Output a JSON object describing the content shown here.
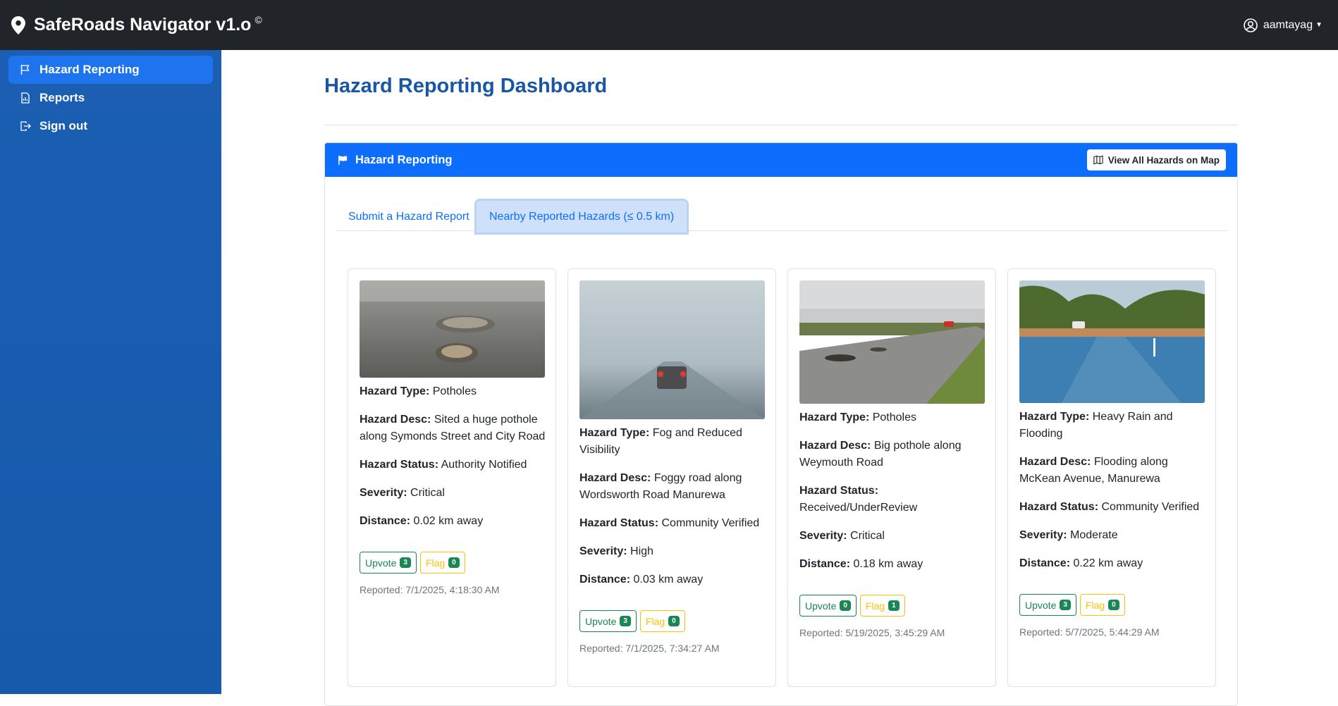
{
  "app": {
    "title": "SafeRoads Navigator v1.o",
    "copyright_mark": "©",
    "user": "aamtayag"
  },
  "sidebar": {
    "items": [
      {
        "label": "Hazard Reporting",
        "icon": "flag-icon",
        "active": true
      },
      {
        "label": "Reports",
        "icon": "report-icon",
        "active": false
      },
      {
        "label": "Sign out",
        "icon": "sign-out-icon",
        "active": false
      }
    ]
  },
  "main": {
    "page_title": "Hazard Reporting Dashboard",
    "panel": {
      "title": "Hazard Reporting",
      "map_button": "View All Hazards on Map"
    },
    "tabs": [
      {
        "label": "Submit a Hazard Report",
        "active": false
      },
      {
        "label": "Nearby Reported Hazards (≤ 0.5 km)",
        "active": true
      }
    ],
    "field_labels": {
      "type": "Hazard Type:",
      "desc": "Hazard Desc:",
      "status": "Hazard Status:",
      "severity": "Severity:",
      "distance": "Distance:"
    },
    "button_labels": {
      "upvote": "Upvote",
      "flag": "Flag"
    },
    "hazards": [
      {
        "type": "Potholes",
        "desc": "Sited a huge pothole along Symonds Street and City Road",
        "status": "Authority Notified",
        "severity": "Critical",
        "distance": "0.02 km away",
        "upvotes": "3",
        "flags": "0",
        "reported": "Reported: 7/1/2025, 4:18:30 AM",
        "image": "pothole-photo"
      },
      {
        "type": "Fog and Reduced Visibility",
        "desc": "Foggy road along Wordsworth Road Manurewa",
        "status": "Community Verified",
        "severity": "High",
        "distance": "0.03 km away",
        "upvotes": "3",
        "flags": "0",
        "reported": "Reported: 7/1/2025, 7:34:27 AM",
        "image": "fog-photo"
      },
      {
        "type": "Potholes",
        "desc": "Big pothole along Weymouth Road",
        "status": "Received/UnderReview",
        "severity": "Critical",
        "distance": "0.18 km away",
        "upvotes": "0",
        "flags": "1",
        "reported": "Reported: 5/19/2025, 3:45:29 AM",
        "image": "rural-pothole-photo"
      },
      {
        "type": "Heavy Rain and Flooding",
        "desc": "Flooding along McKean Avenue, Manurewa",
        "status": "Community Verified",
        "severity": "Moderate",
        "distance": "0.22 km away",
        "upvotes": "3",
        "flags": "0",
        "reported": "Reported: 5/7/2025, 5:44:29 AM",
        "image": "flood-photo"
      }
    ]
  },
  "colors": {
    "navbar": "#212529",
    "sidebar": "#1a5fb4",
    "primary": "#0d6efd",
    "title": "#1957a5",
    "success": "#198754",
    "warning": "#ffc107"
  }
}
